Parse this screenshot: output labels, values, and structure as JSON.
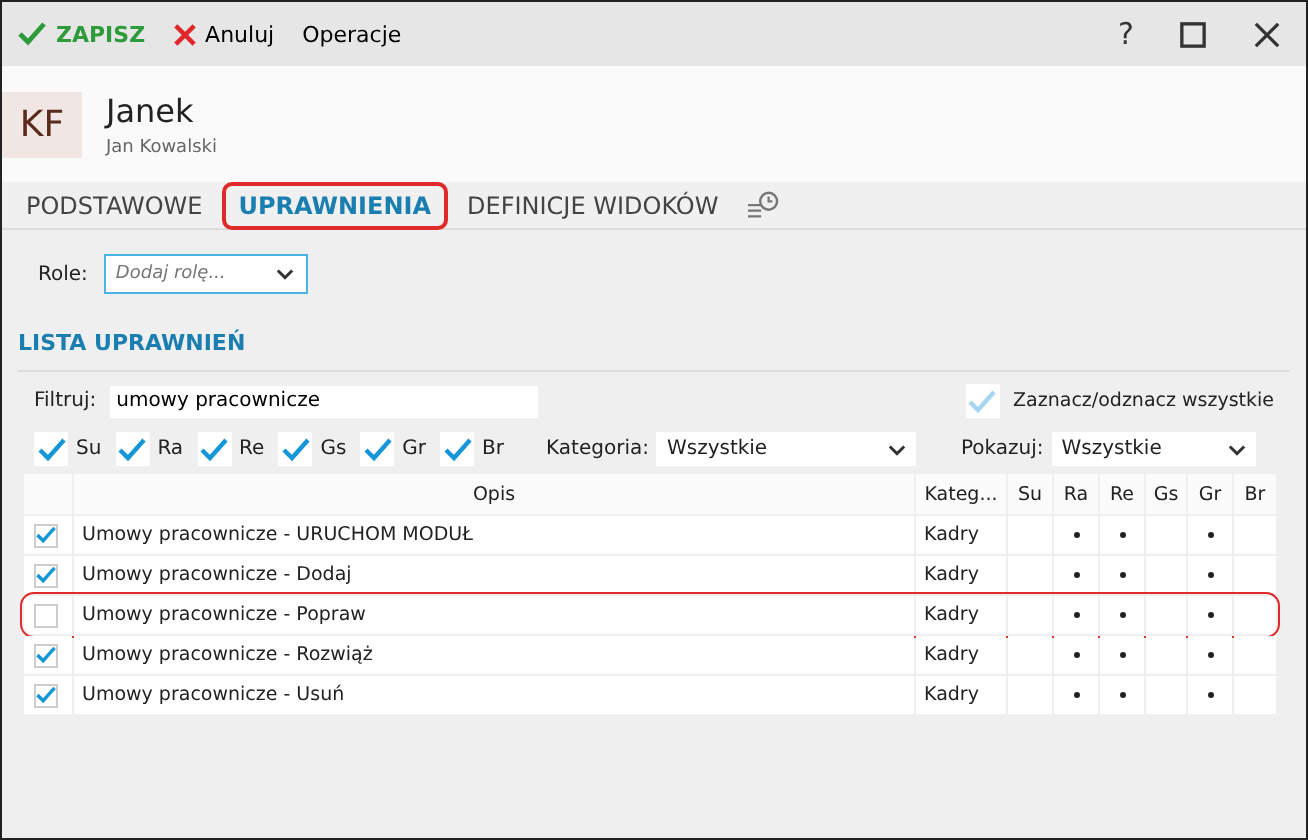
{
  "toolbar": {
    "save": "ZAPISZ",
    "cancel": "Anuluj",
    "operations": "Operacje"
  },
  "window_controls": {
    "help": "?"
  },
  "header": {
    "initials": "KF",
    "name": "Janek",
    "subtitle": "Jan Kowalski"
  },
  "tabs": [
    {
      "label": "PODSTAWOWE",
      "selected": false,
      "annotated": false
    },
    {
      "label": "UPRAWNIENIA",
      "selected": true,
      "annotated": true
    },
    {
      "label": "DEFINICJE WIDOKÓW",
      "selected": false,
      "annotated": false
    }
  ],
  "roles": {
    "label": "Role:",
    "placeholder": "Dodaj rolę..."
  },
  "section_title": "LISTA UPRAWNIEŃ",
  "filter": {
    "label": "Filtruj:",
    "value": "umowy pracownicze"
  },
  "select_all": {
    "label": "Zaznacz/odznacz wszystkie",
    "checked": true,
    "disabled": true
  },
  "rights_filters": [
    {
      "label": "Su",
      "checked": true
    },
    {
      "label": "Ra",
      "checked": true
    },
    {
      "label": "Re",
      "checked": true
    },
    {
      "label": "Gs",
      "checked": true
    },
    {
      "label": "Gr",
      "checked": true
    },
    {
      "label": "Br",
      "checked": true
    }
  ],
  "category": {
    "label": "Kategoria:",
    "value": "Wszystkie"
  },
  "show": {
    "label": "Pokazuj:",
    "value": "Wszystkie"
  },
  "table": {
    "columns": [
      "Opis",
      "Kateg...",
      "Su",
      "Ra",
      "Re",
      "Gs",
      "Gr",
      "Br"
    ],
    "rows": [
      {
        "checked": true,
        "annotated": false,
        "description": "Umowy pracownicze - URUCHOM MODUŁ",
        "category": "Kadry",
        "rights": [
          false,
          true,
          true,
          false,
          true,
          false
        ]
      },
      {
        "checked": true,
        "annotated": false,
        "description": "Umowy pracownicze - Dodaj",
        "category": "Kadry",
        "rights": [
          false,
          true,
          true,
          false,
          true,
          false
        ]
      },
      {
        "checked": false,
        "annotated": true,
        "description": "Umowy pracownicze - Popraw",
        "category": "Kadry",
        "rights": [
          false,
          true,
          true,
          false,
          true,
          false
        ]
      },
      {
        "checked": true,
        "annotated": false,
        "description": "Umowy pracownicze - Rozwiąż",
        "category": "Kadry",
        "rights": [
          false,
          true,
          true,
          false,
          true,
          false
        ]
      },
      {
        "checked": true,
        "annotated": false,
        "description": "Umowy pracownicze - Usuń",
        "category": "Kadry",
        "rights": [
          false,
          true,
          true,
          false,
          true,
          false
        ]
      }
    ]
  }
}
